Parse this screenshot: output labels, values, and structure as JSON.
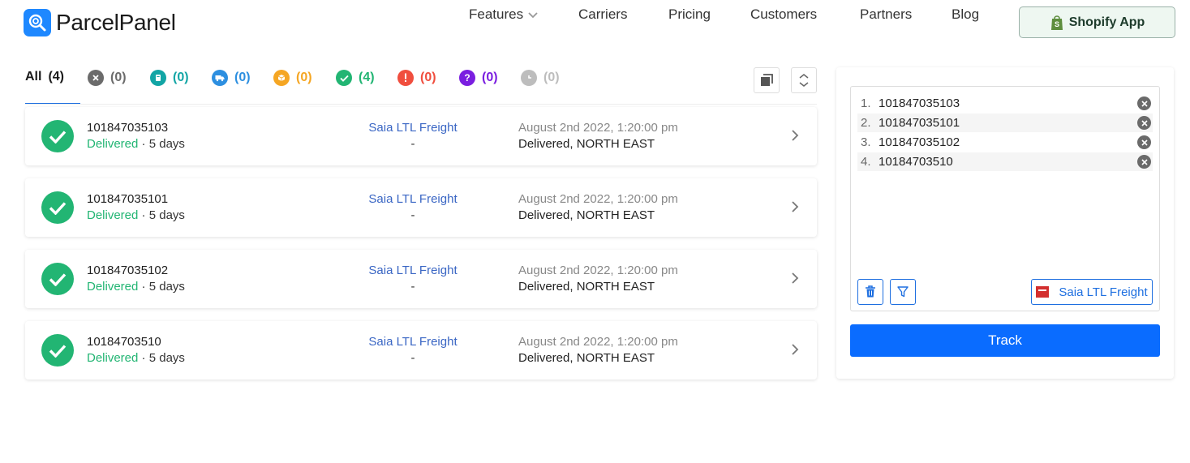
{
  "brand": {
    "name": "ParcelPanel",
    "accent": "#1e88ff"
  },
  "nav": {
    "items": [
      "Features",
      "Carriers",
      "Pricing",
      "Customers",
      "Partners",
      "Blog"
    ],
    "cta": "Shopify App"
  },
  "tabs": [
    {
      "label": "All",
      "count": "(4)",
      "icon": "all",
      "color": "#1a1a1a"
    },
    {
      "label": "",
      "count": "(0)",
      "icon": "x-circle-icon",
      "color": "#6b6b6b"
    },
    {
      "label": "",
      "count": "(0)",
      "icon": "info-received-icon",
      "color": "#12a5a5"
    },
    {
      "label": "",
      "count": "(0)",
      "icon": "truck-icon",
      "color": "#2d8fe0"
    },
    {
      "label": "",
      "count": "(0)",
      "icon": "package-icon",
      "color": "#f5a623"
    },
    {
      "label": "",
      "count": "(4)",
      "icon": "check-circle-icon",
      "color": "#22b573"
    },
    {
      "label": "",
      "count": "(0)",
      "icon": "exclamation-icon",
      "color": "#f04e3e"
    },
    {
      "label": "",
      "count": "(0)",
      "icon": "question-icon",
      "color": "#7a1ee0"
    },
    {
      "label": "",
      "count": "(0)",
      "icon": "clock-icon",
      "color": "#bdbdbd"
    }
  ],
  "shipments": [
    {
      "number": "101847035103",
      "status": "Delivered",
      "duration": "5 days",
      "carrier": "Saia LTL Freight",
      "extra": "-",
      "date": "August 2nd 2022, 1:20:00 pm",
      "location": "Delivered, NORTH EAST"
    },
    {
      "number": "101847035101",
      "status": "Delivered",
      "duration": "5 days",
      "carrier": "Saia LTL Freight",
      "extra": "-",
      "date": "August 2nd 2022, 1:20:00 pm",
      "location": "Delivered, NORTH EAST"
    },
    {
      "number": "101847035102",
      "status": "Delivered",
      "duration": "5 days",
      "carrier": "Saia LTL Freight",
      "extra": "-",
      "date": "August 2nd 2022, 1:20:00 pm",
      "location": "Delivered, NORTH EAST"
    },
    {
      "number": "10184703510",
      "status": "Delivered",
      "duration": "5 days",
      "carrier": "Saia LTL Freight",
      "extra": "-",
      "date": "August 2nd 2022, 1:20:00 pm",
      "location": "Delivered, NORTH EAST"
    }
  ],
  "tracking_input": {
    "entries": [
      {
        "index": "1.",
        "number": "101847035103"
      },
      {
        "index": "2.",
        "number": "101847035101"
      },
      {
        "index": "3.",
        "number": "101847035102"
      },
      {
        "index": "4.",
        "number": "10184703510"
      }
    ],
    "carrier": "Saia LTL Freight",
    "track_label": "Track"
  }
}
